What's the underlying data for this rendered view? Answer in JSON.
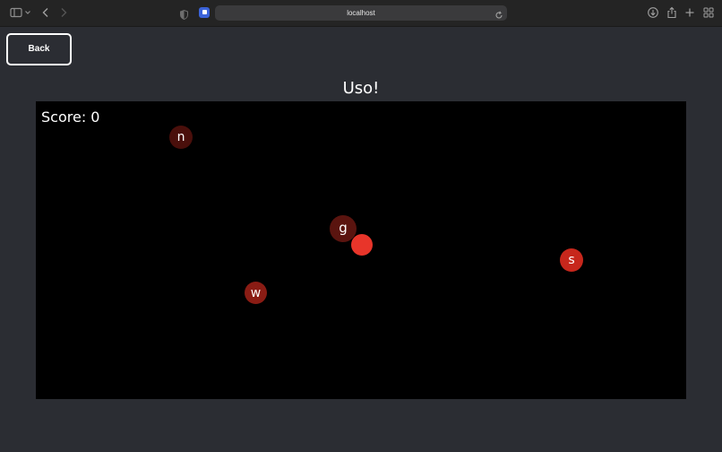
{
  "browser": {
    "url": "localhost"
  },
  "page": {
    "back_label": "Back",
    "title": "Uso!"
  },
  "game": {
    "score_label": "Score: 0",
    "letters": [
      {
        "char": "n",
        "color": "#4a0f0b"
      },
      {
        "char": "g",
        "color": "#5a140f"
      },
      {
        "char": "w",
        "color": "#8a1c14"
      },
      {
        "char": "s",
        "color": "#c7271c"
      }
    ],
    "player": {
      "color": "#e8352a"
    }
  }
}
